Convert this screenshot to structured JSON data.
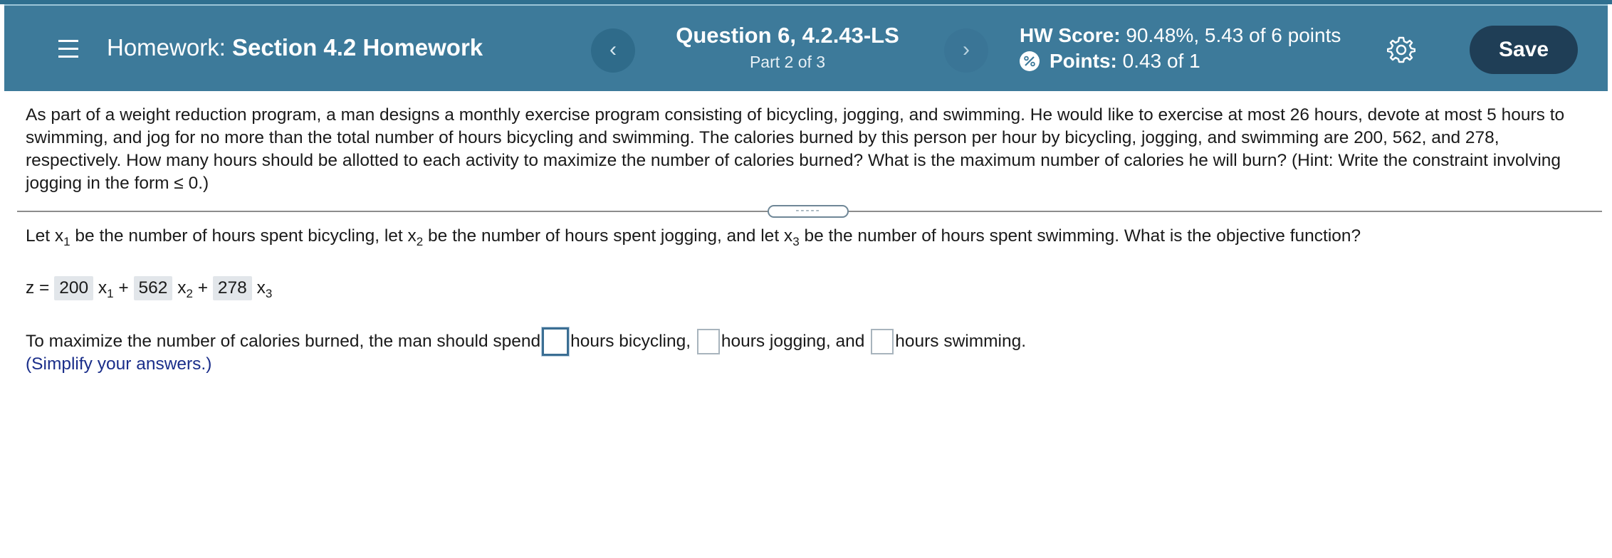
{
  "header": {
    "hw_label": "Homework:",
    "hw_section": "Section 4.2 Homework",
    "question_title": "Question 6, 4.2.43-LS",
    "part": "Part 2 of 3",
    "score_label": "HW Score:",
    "score_value": "90.48%, 5.43 of 6 points",
    "points_label": "Points:",
    "points_value": "0.43 of 1",
    "prev_glyph": "‹",
    "next_glyph": "›",
    "save_label": "Save",
    "bg_color": "#3d7a9a",
    "save_color": "#1f3e56"
  },
  "problem_text": "As part of a weight reduction program, a man designs a monthly exercise program consisting of bicycling, jogging, and swimming. He would like to exercise at most 26 hours, devote at most 5 hours to swimming, and jog for no more than the total number of hours bicycling and swimming. The calories burned by this person per hour by bicycling, jogging, and swimming are 200, 562, and 278, respectively. How many hours should be allotted to each activity to maximize the number of calories burned? What is the maximum number of calories he will burn? (Hint: Write the constraint involving jogging in the form  ≤ 0.)",
  "divider_handle": "-----",
  "let_line": {
    "p1": "Let x",
    "s1": "1",
    "p2": " be the number of hours spent bicycling, let x",
    "s2": "2",
    "p3": " be the number of hours spent jogging, and let x",
    "s3": "3",
    "p4": " be the number of hours spent swimming. What is the objective function?"
  },
  "objective": {
    "prefix": "z =",
    "c1": "200",
    "c2": "562",
    "c3": "278",
    "var": "x",
    "plus": "+"
  },
  "maximize": {
    "lead": "To maximize the number of calories burned, the man should spend",
    "after1": "hours bicycling,",
    "after2": "hours jogging, and",
    "after3": "hours swimming."
  },
  "simplify_hint": "(Simplify your answers.)"
}
